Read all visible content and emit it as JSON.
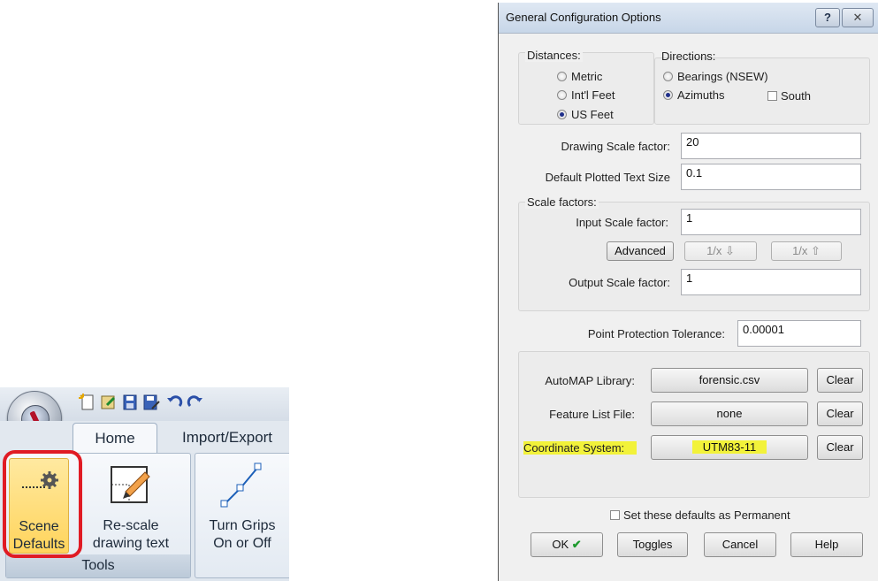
{
  "ribbon": {
    "tabs": [
      "Home",
      "Import/Export"
    ],
    "buttons": {
      "scene_defaults": [
        "Scene",
        "Defaults"
      ],
      "rescale_text": [
        "Re-scale",
        "drawing text"
      ],
      "turn_grips": [
        "Turn Grips",
        "On or Off"
      ]
    },
    "group_label": "Tools",
    "highlight_color": "#e01b24"
  },
  "dialog": {
    "title": "General Configuration Options",
    "help_glyph": "?",
    "close_glyph": "✕",
    "distances": {
      "label": "Distances:",
      "options": [
        "Metric",
        "Int'l Feet",
        "US Feet"
      ],
      "selected": "US Feet"
    },
    "directions": {
      "label": "Directions:",
      "options": [
        "Bearings (NSEW)",
        "Azimuths"
      ],
      "selected": "Azimuths",
      "south_label": "South",
      "south_checked": false
    },
    "drawing_scale": {
      "label": "Drawing Scale factor:",
      "value": "20"
    },
    "plotted_text": {
      "label": "Default Plotted Text Size",
      "value": "0.1"
    },
    "scale_factors": {
      "label": "Scale factors:",
      "input_label": "Input Scale factor:",
      "input_value": "1",
      "advanced_label": "Advanced",
      "recip_down_label": "1/x ⇩",
      "recip_up_label": "1/x ⇧",
      "output_label": "Output Scale factor:",
      "output_value": "1"
    },
    "point_tolerance": {
      "label": "Point Protection Tolerance:",
      "value": "0.00001"
    },
    "files": {
      "automap_label": "AutoMAP Library:",
      "automap_value": "forensic.csv",
      "feature_label": "Feature List File:",
      "feature_value": "none",
      "coord_label": "Coordinate System:",
      "coord_value": "UTM83-11",
      "clear_label": "Clear",
      "highlight_color": "#f2f23a"
    },
    "permanent": {
      "label": "Set these defaults as Permanent",
      "checked": false
    },
    "footer": {
      "ok_label": "OK",
      "ok_mark": "✔",
      "toggles_label": "Toggles",
      "cancel_label": "Cancel",
      "help_label": "Help"
    }
  }
}
